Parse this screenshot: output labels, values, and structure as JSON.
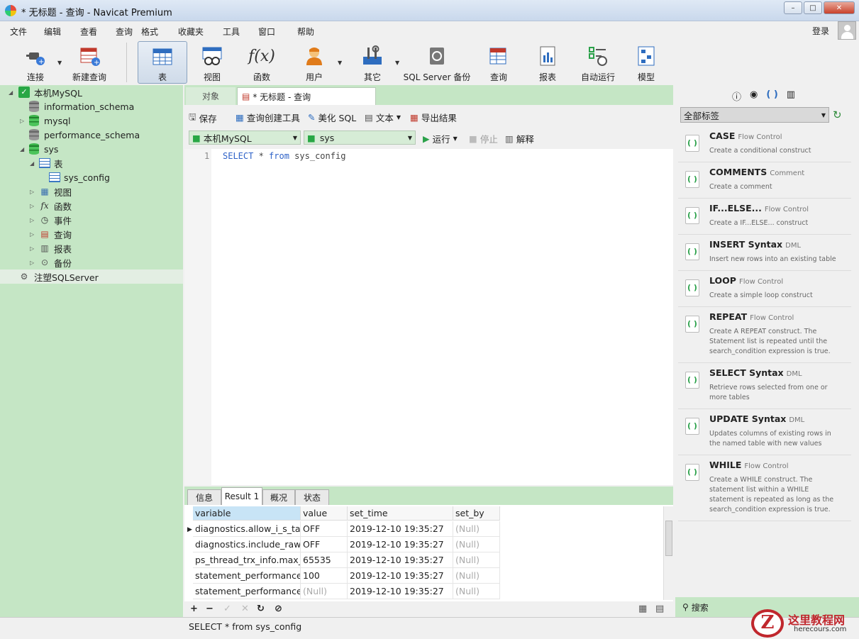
{
  "window": {
    "title": "* 无标题 - 查询 - Navicat Premium",
    "min": "–",
    "max": "□",
    "close": "✕"
  },
  "menu": [
    "文件",
    "编辑",
    "查看",
    "查询",
    "格式",
    "收藏夹",
    "工具",
    "窗口",
    "帮助"
  ],
  "login": "登录",
  "toolbar": {
    "connect": "连接",
    "new_query": "新建查询",
    "table": "表",
    "view": "视图",
    "function": "函数",
    "user": "用户",
    "other": "其它",
    "backup": "SQL Server 备份",
    "query": "查询",
    "report": "报表",
    "autorun": "自动运行",
    "model": "模型"
  },
  "tree": {
    "conn1": "本机MySQL",
    "db_info": "information_schema",
    "db_mysql": "mysql",
    "db_perf": "performance_schema",
    "db_sys": "sys",
    "tables": "表",
    "sys_config": "sys_config",
    "views": "视图",
    "functions": "函数",
    "events": "事件",
    "queries": "查询",
    "reports": "报表",
    "backups": "备份",
    "conn2": "注塑SQLServer"
  },
  "tabs": {
    "objects": "对象",
    "query_tab": "* 无标题 - 查询"
  },
  "sql_toolbar": {
    "save": "保存",
    "builder": "查询创建工具",
    "beautify": "美化 SQL",
    "text": "文本",
    "export": "导出结果",
    "connection": "本机MySQL",
    "database": "sys",
    "run": "运行",
    "stop": "停止",
    "explain": "解释"
  },
  "editor": {
    "line": "1",
    "kw1": "SELECT",
    "mid": " * ",
    "kw2": "from",
    "rest": " sys_config"
  },
  "result_tabs": [
    "信息",
    "Result 1",
    "概况",
    "状态"
  ],
  "grid": {
    "columns": [
      "variable",
      "value",
      "set_time",
      "set_by"
    ],
    "rows": [
      [
        "diagnostics.allow_i_s_tables",
        "OFF",
        "2019-12-10 19:35:27",
        "(Null)"
      ],
      [
        "diagnostics.include_raw",
        "OFF",
        "2019-12-10 19:35:27",
        "(Null)"
      ],
      [
        "ps_thread_trx_info.max_length",
        "65535",
        "2019-12-10 19:35:27",
        "(Null)"
      ],
      [
        "statement_performance_analyzer.limit",
        "100",
        "2019-12-10 19:35:27",
        "(Null)"
      ],
      [
        "statement_performance_analyzer.view",
        "(Null)",
        "2019-12-10 19:35:27",
        "(Null)"
      ]
    ]
  },
  "right_panel": {
    "tag_filter": "全部标签",
    "search": "搜索",
    "snippets": [
      {
        "title": "CASE",
        "type": "Flow Control",
        "desc": "Create a conditional construct"
      },
      {
        "title": "COMMENTS",
        "type": "Comment",
        "desc": "Create a comment"
      },
      {
        "title": "IF...ELSE...",
        "type": "Flow Control",
        "desc": "Create a IF...ELSE... construct"
      },
      {
        "title": "INSERT Syntax",
        "type": "DML",
        "desc": "Insert new rows into an existing table"
      },
      {
        "title": "LOOP",
        "type": "Flow Control",
        "desc": "Create a simple loop construct"
      },
      {
        "title": "REPEAT",
        "type": "Flow Control",
        "desc": "Create A REPEAT construct. The Statement list is repeated until the search_condition expression is true."
      },
      {
        "title": "SELECT Syntax",
        "type": "DML",
        "desc": "Retrieve rows selected from one or more tables"
      },
      {
        "title": "UPDATE Syntax",
        "type": "DML",
        "desc": "Updates columns of existing rows in the named table with new values"
      },
      {
        "title": "WHILE",
        "type": "Flow Control",
        "desc": "Create a WHILE construct. The statement list within a WHILE statement is repeated as long as the search_condition expression is true."
      }
    ]
  },
  "status": "SELECT * from sys_config",
  "watermark": {
    "line1": "这里教程网",
    "line2": "herecours.com"
  }
}
